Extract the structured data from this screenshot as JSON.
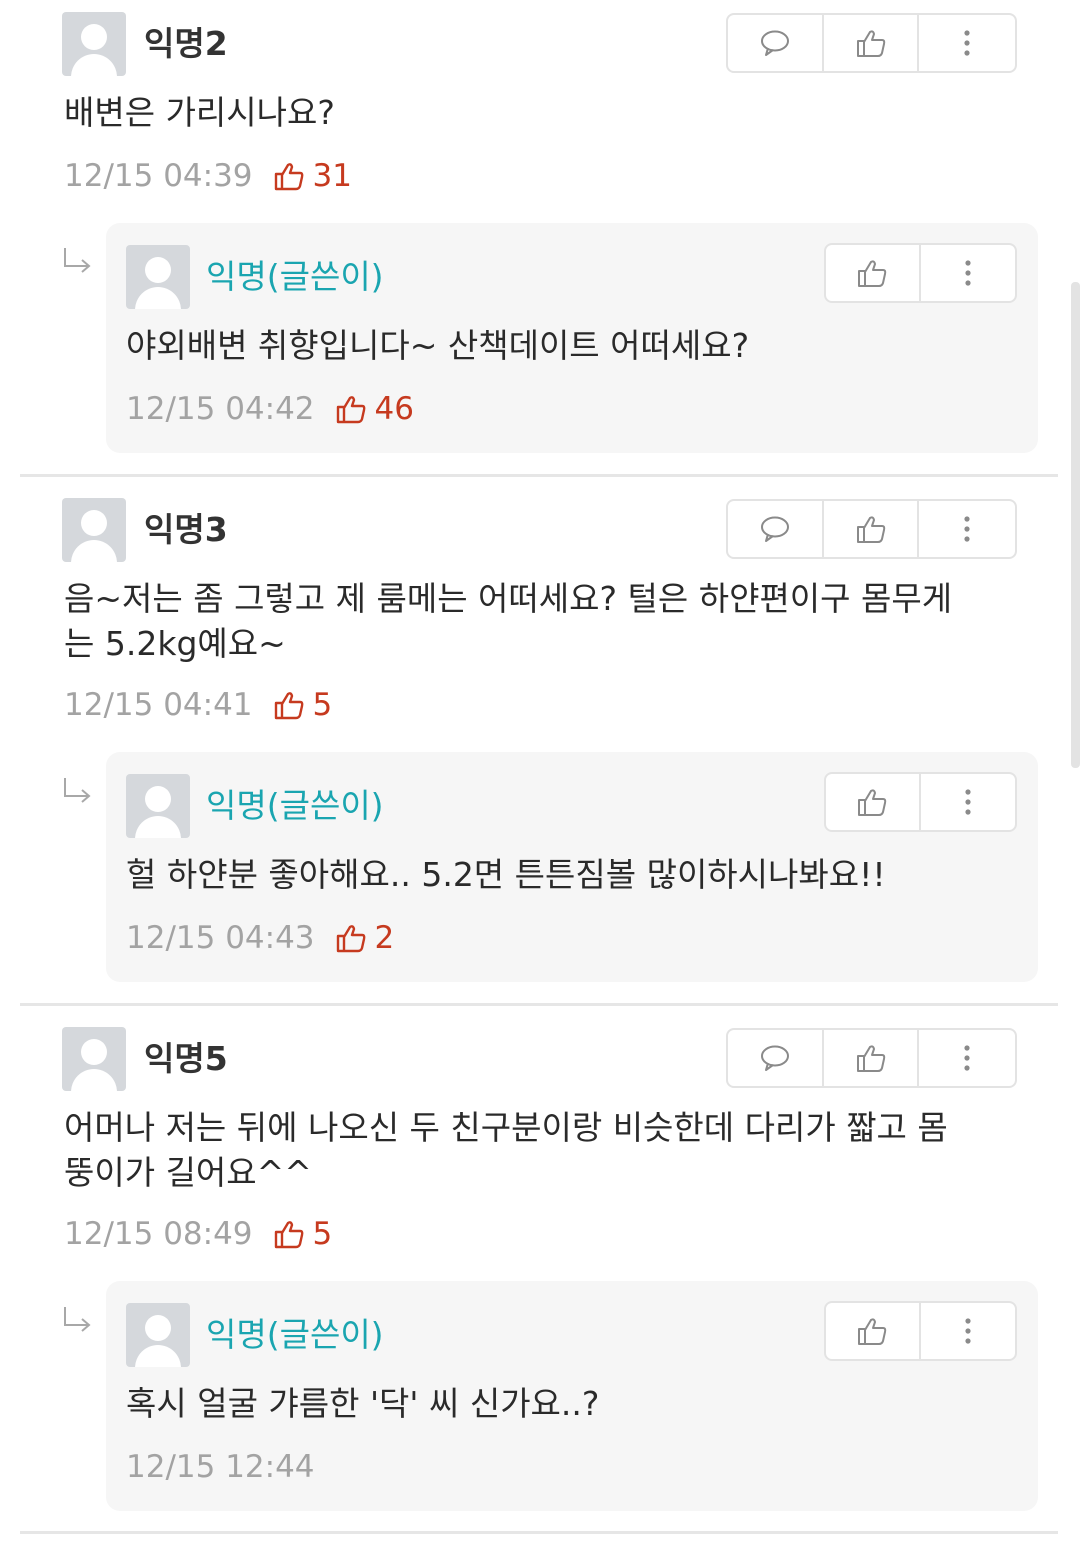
{
  "threads": [
    {
      "comment": {
        "author": "익명2",
        "text": "배변은 가리시나요?",
        "time": "12/15 04:39",
        "likes": "31"
      },
      "reply": {
        "author": "익명(글쓴이)",
        "text": "야외배변 취향입니다~ 산책데이트 어떠세요?",
        "time": "12/15 04:42",
        "likes": "46"
      }
    },
    {
      "comment": {
        "author": "익명3",
        "text": "음~저는 좀 그렇고 제 룸메는 어떠세요? 털은 하얀편이구 몸무게는 5.2kg예요~",
        "time": "12/15 04:41",
        "likes": "5"
      },
      "reply": {
        "author": "익명(글쓴이)",
        "text": "헐 하얀분 좋아해요.. 5.2면 튼튼짐볼 많이하시나봐요!!",
        "time": "12/15 04:43",
        "likes": "2"
      }
    },
    {
      "comment": {
        "author": "익명5",
        "text": "어머나 저는 뒤에 나오신 두 친구분이랑 비슷한데 다리가 짧고 몸뚱이가 길어요^^",
        "time": "12/15 08:49",
        "likes": "5"
      },
      "reply": {
        "author": "익명(글쓴이)",
        "text": "혹시 얼굴 갸름한 '닥' 씨 신가요..?",
        "time": "12/15 12:44",
        "likes": ""
      }
    }
  ],
  "icons": {
    "comment": "speech-bubble-icon",
    "like": "thumbs-up-icon",
    "more": "vertical-ellipsis-icon",
    "reply_indicator": "reply-arrow-icon"
  },
  "colors": {
    "author_name": "#1aa5b0",
    "like_count": "#c63a1f",
    "meta_text": "#a3a3a3",
    "reply_background": "#f6f6f6"
  }
}
